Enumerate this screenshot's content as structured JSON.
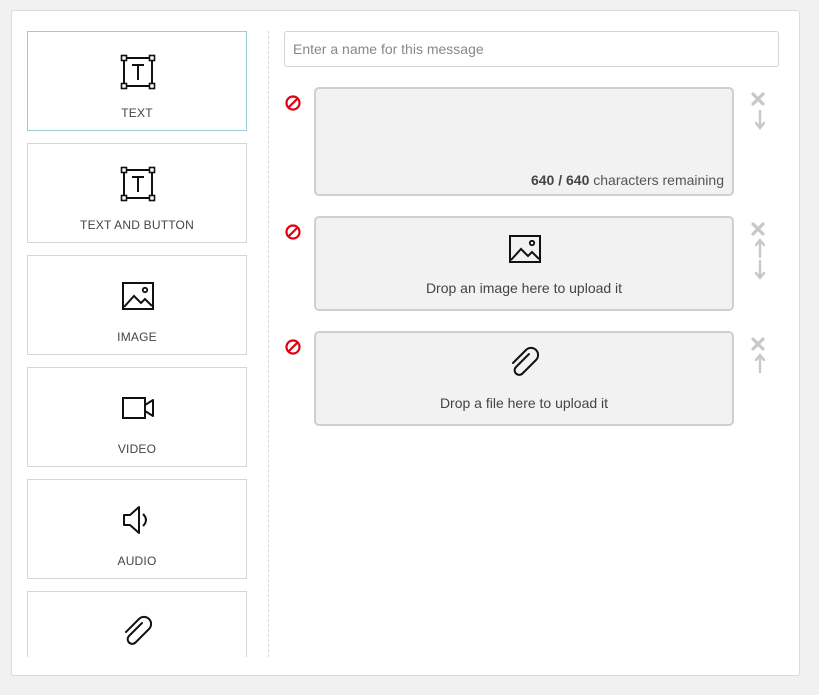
{
  "sidebar": {
    "items": [
      {
        "label": "TEXT",
        "icon": "text-box-icon"
      },
      {
        "label": "TEXT AND BUTTON",
        "icon": "text-box-icon"
      },
      {
        "label": "IMAGE",
        "icon": "image-icon"
      },
      {
        "label": "VIDEO",
        "icon": "video-camera-icon"
      },
      {
        "label": "AUDIO",
        "icon": "speaker-icon"
      },
      {
        "label": "",
        "icon": "paperclip-icon"
      }
    ]
  },
  "message": {
    "name_placeholder": "Enter a name for this message",
    "name_value": ""
  },
  "blocks": {
    "text": {
      "remaining": "640",
      "separator": " / ",
      "total": "640",
      "suffix": " characters remaining"
    },
    "image": {
      "drop_text": "Drop an image here to upload it"
    },
    "file": {
      "drop_text": "Drop a file here to upload it"
    }
  },
  "colors": {
    "remove": "#e0000f",
    "controls": "#c8c8c8",
    "active_border": "#9ec9d9"
  }
}
